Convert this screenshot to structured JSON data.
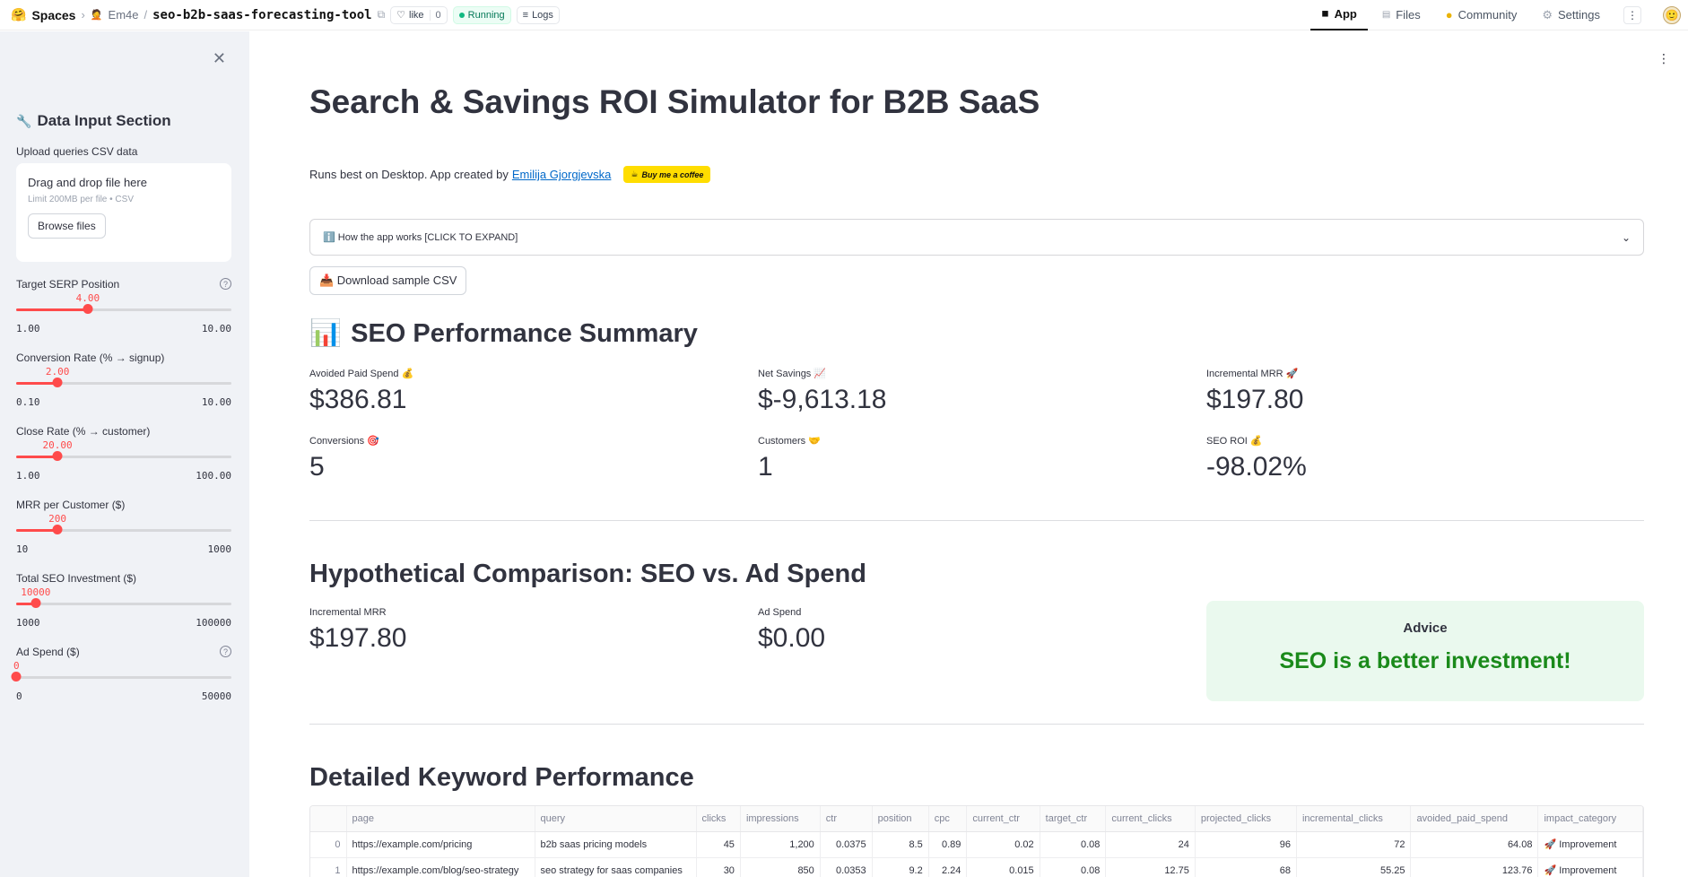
{
  "topbar": {
    "logo": "🤗",
    "spaces": "Spaces",
    "owner_icon": "🤦",
    "owner": "Em4e",
    "repo": "seo-b2b-saas-forecasting-tool",
    "like_label": "like",
    "like_count": "0",
    "status": "Running",
    "logs": "Logs",
    "tabs": [
      {
        "icon": "app-icon",
        "label": "App"
      },
      {
        "icon": "files-icon",
        "label": "Files"
      },
      {
        "icon": "community-icon",
        "label": "Community"
      },
      {
        "icon": "settings-icon",
        "label": "Settings"
      }
    ]
  },
  "sidebar": {
    "title": "Data Input Section",
    "title_icon": "wrench-icon",
    "upload_label": "Upload queries CSV data",
    "upload_title": "Drag and drop file here",
    "upload_sub": "Limit 200MB per file • CSV",
    "browse": "Browse files",
    "sliders": [
      {
        "label": "Target SERP Position",
        "value": "4.00",
        "min": "1.00",
        "max": "10.00",
        "fraction": 0.333,
        "help": true
      },
      {
        "label": "Conversion Rate (% → signup)",
        "value": "2.00",
        "min": "0.10",
        "max": "10.00",
        "fraction": 0.192,
        "help": false
      },
      {
        "label": "Close Rate (% → customer)",
        "value": "20.00",
        "min": "1.00",
        "max": "100.00",
        "fraction": 0.192,
        "help": false
      },
      {
        "label": "MRR per Customer ($)",
        "value": "200",
        "min": "10",
        "max": "1000",
        "fraction": 0.192,
        "help": false
      },
      {
        "label": "Total SEO Investment ($)",
        "value": "10000",
        "min": "1000",
        "max": "100000",
        "fraction": 0.091,
        "help": false
      },
      {
        "label": "Ad Spend ($)",
        "value": "0",
        "min": "0",
        "max": "50000",
        "fraction": 0.0,
        "help": true
      }
    ]
  },
  "main": {
    "title": "Search & Savings ROI Simulator for B2B SaaS",
    "credit_text": "Runs best on Desktop. App created by",
    "credit_link": "Emilija Gjorgjevska",
    "coffee": "Buy me a coffee",
    "expander": "ℹ️ How the app works [CLICK TO EXPAND]",
    "download": "📥 Download sample CSV",
    "summary_title": "SEO Performance Summary",
    "summary_icon": "📊",
    "metrics": [
      {
        "label": "Avoided Paid Spend 💰",
        "value": "$386.81"
      },
      {
        "label": "Net Savings 📈",
        "value": "$-9,613.18"
      },
      {
        "label": "Incremental MRR 🚀",
        "value": "$197.80"
      },
      {
        "label": "Conversions 🎯",
        "value": "5"
      },
      {
        "label": "Customers 🤝",
        "value": "1"
      },
      {
        "label": "SEO ROI 💰",
        "value": "-98.02%"
      }
    ],
    "comparison_title": "Hypothetical Comparison: SEO vs. Ad Spend",
    "comparison_metrics": [
      {
        "label": "Incremental MRR",
        "value": "$197.80"
      },
      {
        "label": "Ad Spend",
        "value": "$0.00"
      }
    ],
    "advice_title": "Advice",
    "advice_text": "SEO is a better investment!",
    "advice_color": "#1a8a1a",
    "keyword_title": "Detailed Keyword Performance",
    "table": {
      "columns": [
        "",
        "page",
        "query",
        "clicks",
        "impressions",
        "ctr",
        "position",
        "cpc",
        "current_ctr",
        "target_ctr",
        "current_clicks",
        "projected_clicks",
        "incremental_clicks",
        "avoided_paid_spend",
        "impact_category"
      ],
      "rows": [
        [
          "0",
          "https://example.com/pricing",
          "b2b saas pricing models",
          "45",
          "1,200",
          "0.0375",
          "8.5",
          "0.89",
          "0.02",
          "0.08",
          "24",
          "96",
          "72",
          "64.08",
          "🚀 Improvement"
        ],
        [
          "1",
          "https://example.com/blog/seo-strategy",
          "seo strategy for saas companies",
          "30",
          "850",
          "0.0353",
          "9.2",
          "2.24",
          "0.015",
          "0.08",
          "12.75",
          "68",
          "55.25",
          "123.76",
          "🚀 Improvement"
        ]
      ]
    }
  }
}
